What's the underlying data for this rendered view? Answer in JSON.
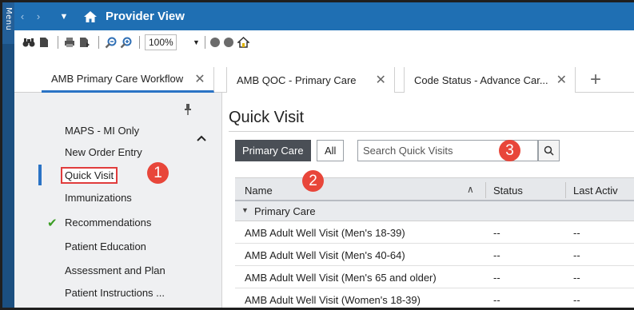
{
  "sidebar_menu_label": "Menu",
  "window": {
    "title": "Provider View"
  },
  "toolbar": {
    "zoom": "100%"
  },
  "tabs": [
    {
      "label": "AMB Primary Care Workflow",
      "active": true
    },
    {
      "label": "AMB QOC - Primary Care",
      "active": false
    },
    {
      "label": "Code Status - Advance Car...",
      "active": false
    }
  ],
  "nav": {
    "items": [
      {
        "label": "MAPS - MI Only"
      },
      {
        "label": "New Order Entry"
      },
      {
        "label": "Quick Visit",
        "current": true
      },
      {
        "label": "Immunizations"
      },
      {
        "label": "Recommendations",
        "checked": true
      },
      {
        "label": "Patient Education"
      },
      {
        "label": "Assessment and Plan"
      },
      {
        "label": "Patient Instructions ..."
      }
    ]
  },
  "main": {
    "title": "Quick Visit",
    "filter_primary": "Primary Care",
    "filter_all": "All",
    "search_placeholder": "Search Quick Visits",
    "columns": [
      "Name",
      "Status",
      "Last Activ"
    ],
    "group": "Primary Care",
    "rows": [
      {
        "name": "AMB Adult Well Visit (Men's 18-39)",
        "status": "--",
        "last": "--"
      },
      {
        "name": "AMB Adult Well Visit (Men's 40-64)",
        "status": "--",
        "last": "--"
      },
      {
        "name": "AMB Adult Well Visit (Men's 65 and older)",
        "status": "--",
        "last": "--"
      },
      {
        "name": "AMB Adult Well Visit (Women's 18-39)",
        "status": "--",
        "last": "--"
      }
    ]
  },
  "callouts": [
    "1",
    "2",
    "3"
  ],
  "colors": {
    "accent": "#1f6fb3",
    "highlight": "#e03c3c",
    "callout": "#e8463a"
  }
}
